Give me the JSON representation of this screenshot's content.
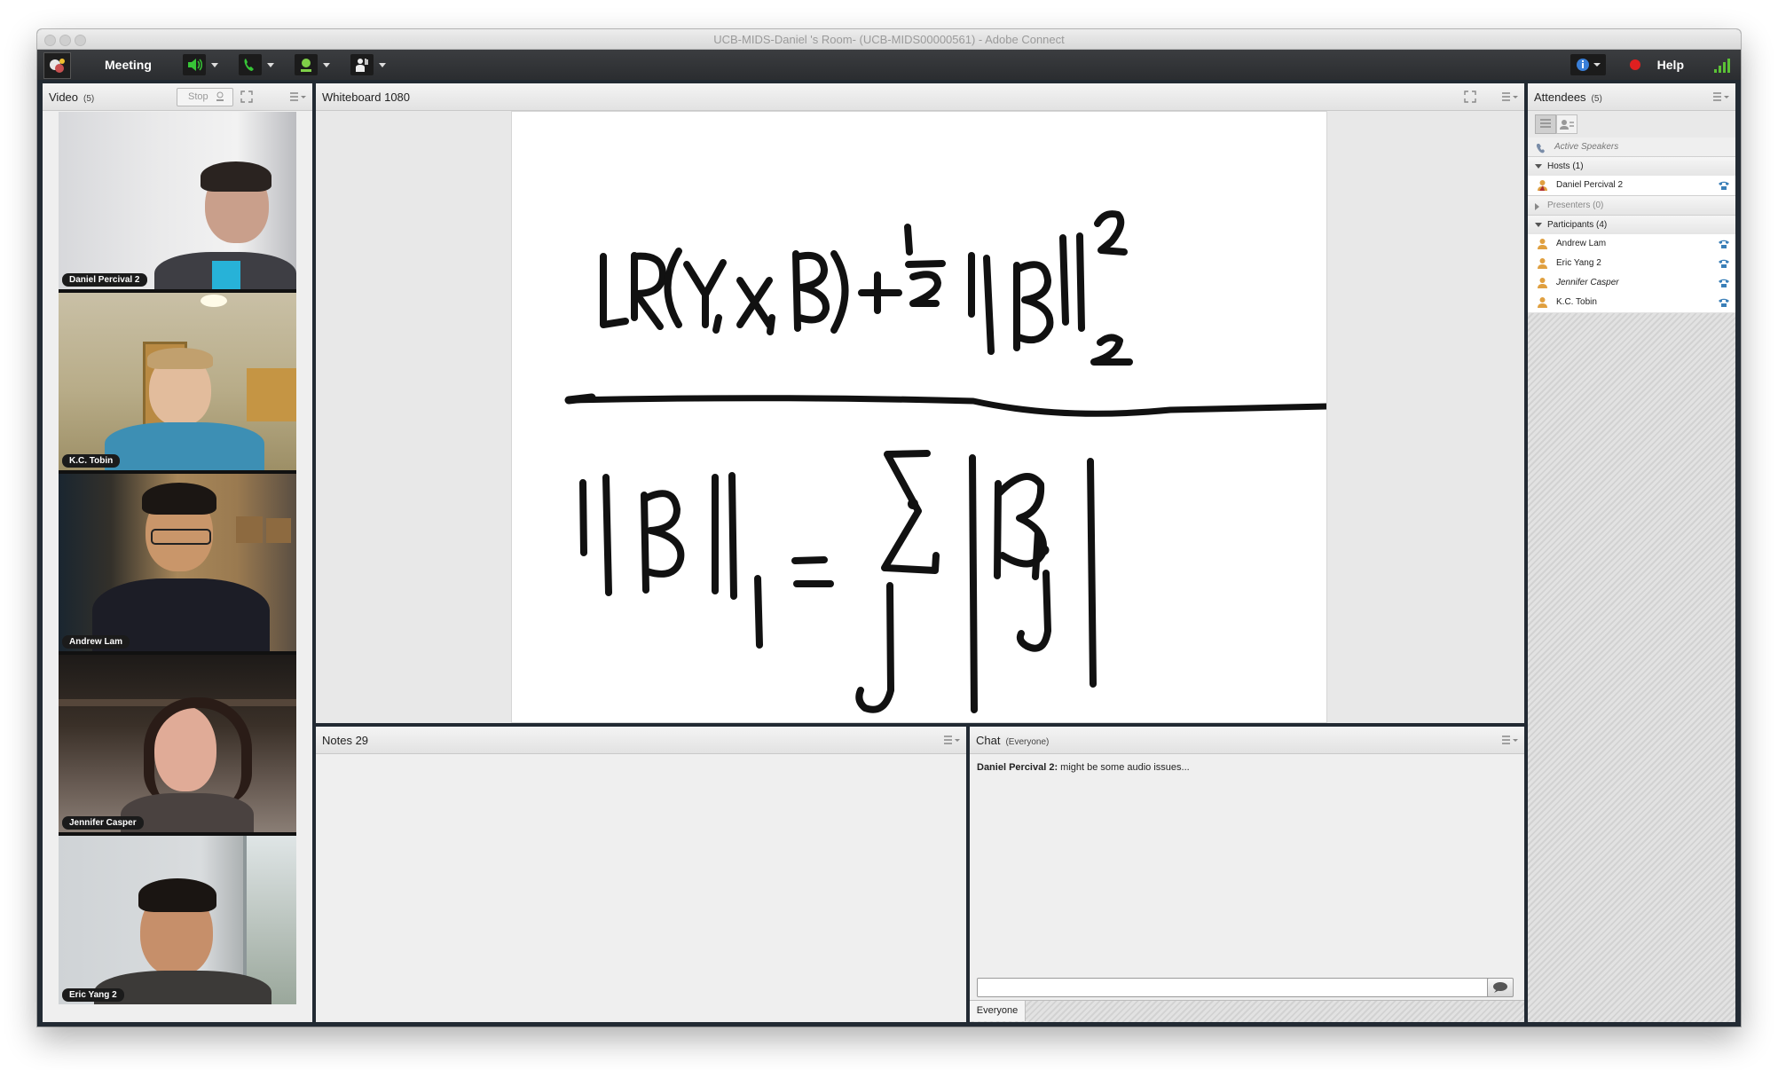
{
  "window": {
    "title": "UCB-MIDS-Daniel 's Room- (UCB-MIDS00000561) - Adobe Connect"
  },
  "toolbar": {
    "meeting_label": "Meeting",
    "help_label": "Help",
    "icons": [
      "adobe-connect-logo-icon",
      "speaker-icon",
      "phone-icon",
      "webcam-icon",
      "raise-hand-icon",
      "info-icon",
      "record-icon",
      "signal-strength-icon"
    ],
    "colors": {
      "speaker": "#37c537",
      "phone": "#37c537",
      "webcam": "#7fd048",
      "record": "#e02020",
      "info": "#3a7fd8"
    }
  },
  "video_pod": {
    "title": "Video",
    "count": "(5)",
    "stop_label": "Stop",
    "tiles": [
      {
        "name": "Daniel Percival 2"
      },
      {
        "name": "K.C. Tobin"
      },
      {
        "name": "Andrew Lam"
      },
      {
        "name": "Jennifer Casper"
      },
      {
        "name": "Eric Yang 2"
      }
    ]
  },
  "whiteboard_pod": {
    "title": "Whiteboard 1080"
  },
  "notes_pod": {
    "title": "Notes 29"
  },
  "chat_pod": {
    "title": "Chat",
    "scope": "(Everyone)",
    "messages": [
      {
        "sender": "Daniel Percival 2:",
        "text": "might be some audio issues..."
      }
    ],
    "input_value": "",
    "tab_label": "Everyone"
  },
  "attendees_pod": {
    "title": "Attendees",
    "count": "(5)",
    "active_speakers_label": "Active Speakers",
    "hosts": {
      "label": "Hosts (1)",
      "users": [
        "Daniel Percival 2"
      ]
    },
    "presenters": {
      "label": "Presenters (0)"
    },
    "participants": {
      "label": "Participants (4)",
      "users": [
        "Andrew Lam",
        "Eric Yang 2",
        "Jennifer Casper",
        "K.C. Tobin"
      ]
    }
  }
}
